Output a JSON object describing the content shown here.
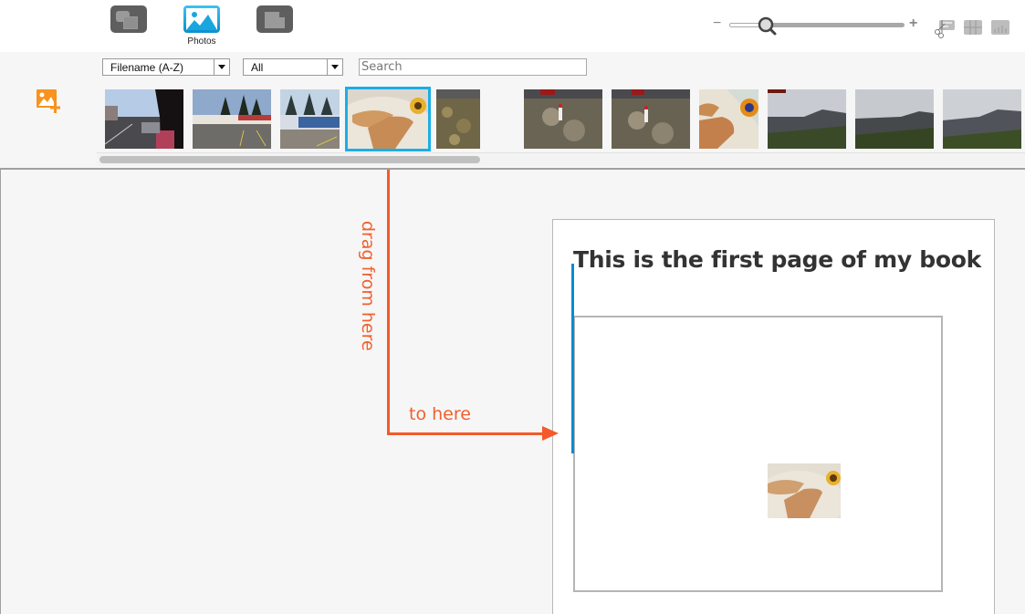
{
  "toolbar": {
    "modes": [
      {
        "name": "layouts",
        "icon": "layouts-icon",
        "label": "",
        "active": false
      },
      {
        "name": "photos",
        "icon": "photos-icon",
        "label": "Photos",
        "active": true
      },
      {
        "name": "pages",
        "icon": "pages-icon",
        "label": "",
        "active": false
      }
    ],
    "zoom": {
      "minus": "−",
      "plus": "+",
      "level": 0.2
    },
    "tools": [
      "crop-scissors-icon",
      "grid-icon",
      "chart-icon"
    ]
  },
  "filters": {
    "sort": {
      "selected": "Filename (A-Z)"
    },
    "type": {
      "selected": "All"
    },
    "search": {
      "placeholder": "Search",
      "value": ""
    }
  },
  "thumbnails": [
    {
      "subject": "parking lot with car",
      "selected": false
    },
    {
      "subject": "roadside restaurant",
      "selected": false
    },
    {
      "subject": "restaurant with pines",
      "selected": false
    },
    {
      "subject": "pastries on plate",
      "selected": true
    },
    {
      "subject": "grassy ground",
      "selected": false
    },
    {
      "subject": "grass with object",
      "selected": false
    },
    {
      "subject": "grass with object",
      "selected": false
    },
    {
      "subject": "pastries close-up",
      "selected": false
    },
    {
      "subject": "mountain landscape",
      "selected": false
    },
    {
      "subject": "mountain landscape",
      "selected": false
    },
    {
      "subject": "mountain landscape",
      "selected": false
    }
  ],
  "page": {
    "title": "This is the first page of my book",
    "dropped_image": "pastries on plate"
  },
  "annotations": {
    "drag_from": "drag from here",
    "drop_to": "to here",
    "color": "#f45a2a"
  },
  "colors": {
    "accent": "#1aafe6",
    "add_photo": "#f7931e",
    "cursor": "#0c8ad0"
  }
}
